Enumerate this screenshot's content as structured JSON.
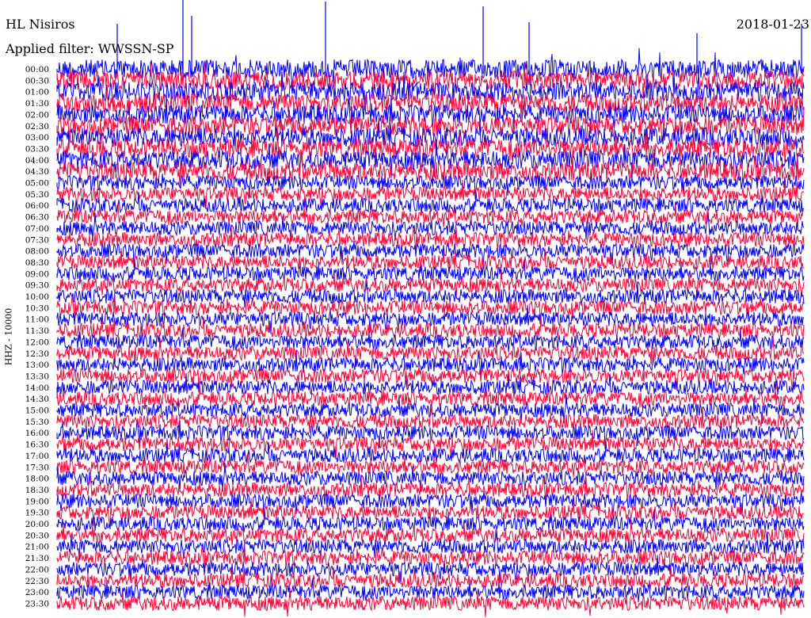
{
  "header": {
    "station": "HL Nisiros",
    "date": "2018-01-23",
    "filter": "Applied filter: WWSSN-SP"
  },
  "chart_data": {
    "type": "line",
    "title": "HL Nisiros",
    "ylabel": "HHZ - 10000",
    "row_times": [
      "00:00",
      "00:30",
      "01:00",
      "01:30",
      "02:00",
      "02:30",
      "03:00",
      "03:30",
      "04:00",
      "04:30",
      "05:00",
      "05:30",
      "06:00",
      "06:30",
      "07:00",
      "07:30",
      "08:00",
      "08:30",
      "09:00",
      "09:30",
      "10:00",
      "10:30",
      "11:00",
      "11:30",
      "12:00",
      "12:30",
      "13:00",
      "13:30",
      "14:00",
      "14:30",
      "15:00",
      "15:30",
      "16:00",
      "16:30",
      "17:00",
      "17:30",
      "18:00",
      "18:30",
      "19:00",
      "19:30",
      "20:00",
      "20:30",
      "21:00",
      "21:30",
      "22:00",
      "22:30",
      "23:00",
      "23:30"
    ],
    "series_colors": [
      "#0000ff",
      "#ff0033"
    ],
    "grid": false
  }
}
